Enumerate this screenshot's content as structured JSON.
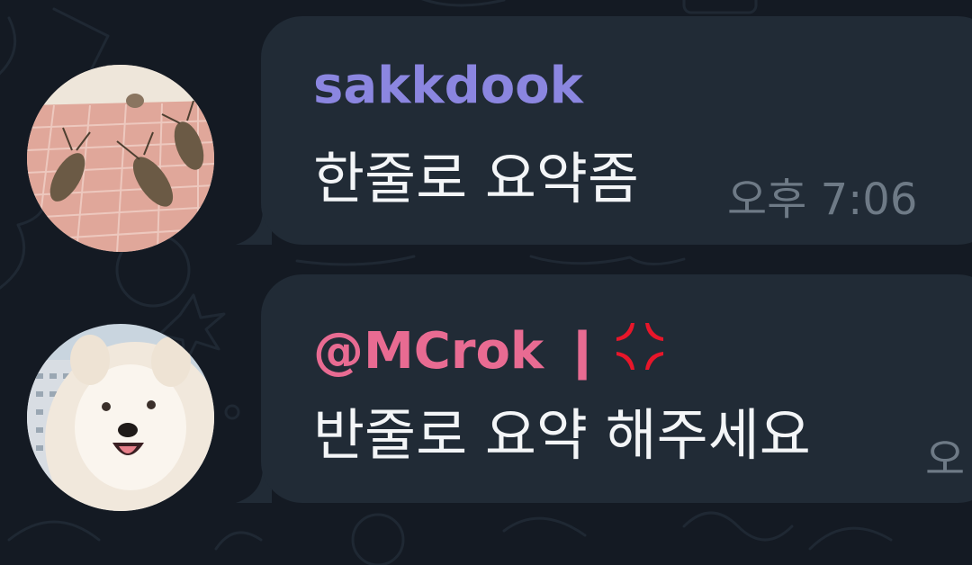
{
  "colors": {
    "background": "#141a23",
    "bubble": "#212b36",
    "sender1": "#8b86e0",
    "sender2": "#e86b92",
    "message_text": "#f3f5f7",
    "timestamp": "#6e7a86",
    "anger_emoji": "#e8162a"
  },
  "messages": [
    {
      "sender": "sakkdook",
      "text": "한줄로 요약좀",
      "time": "오후 7:06",
      "avatar": "cockroach-photo-avatar"
    },
    {
      "sender": "@MCrok ❙",
      "sender_emoji": "anger-symbol-icon",
      "text": "반줄로 요약 해주세요",
      "time": "오",
      "avatar": "samoyed-dog-photo-avatar"
    }
  ]
}
